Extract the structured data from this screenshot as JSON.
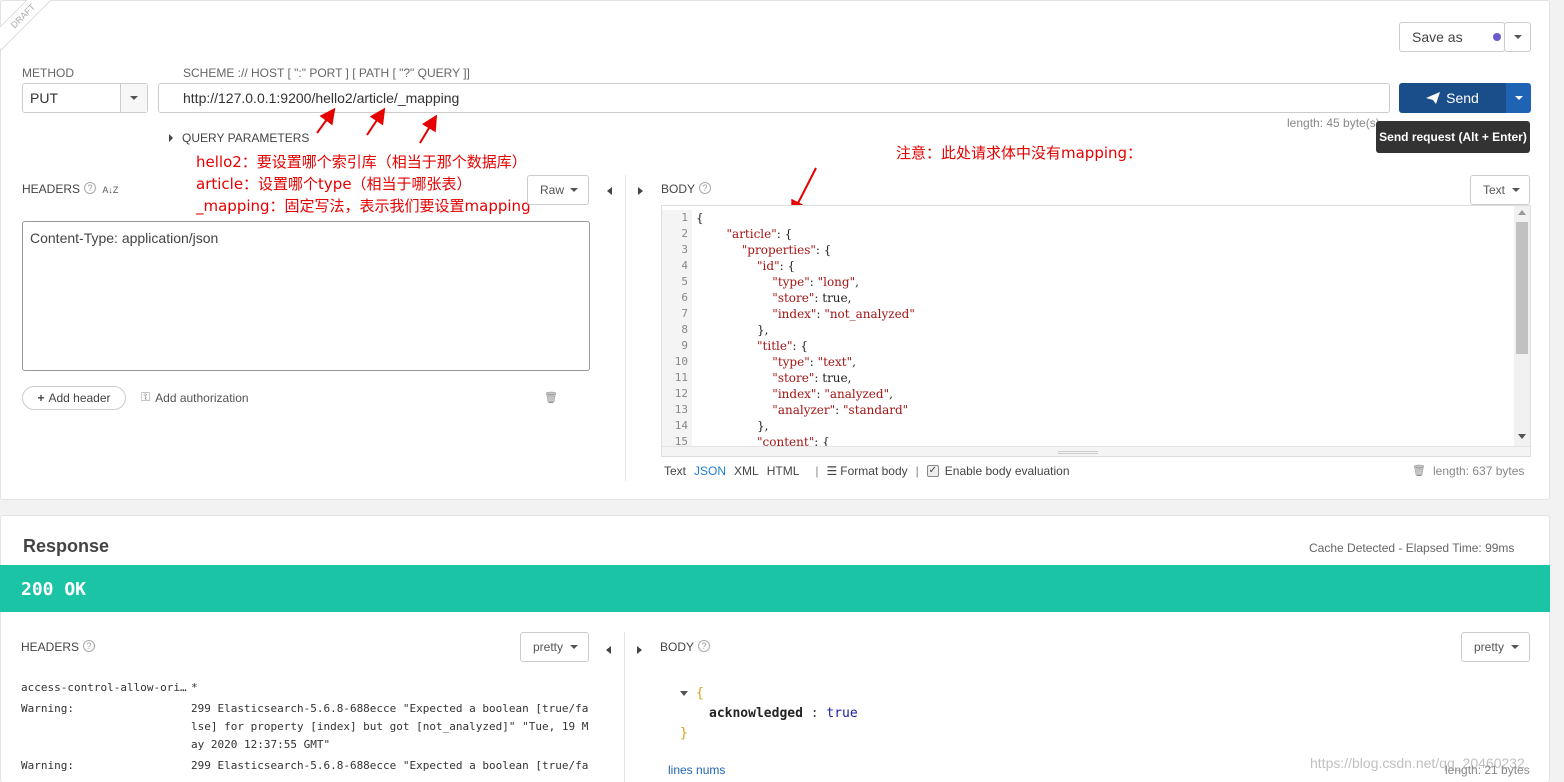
{
  "draft_label": "DRAFT",
  "save_as_label": "Save as",
  "method": {
    "label": "METHOD",
    "value": "PUT"
  },
  "url": {
    "label": "SCHEME :// HOST [ \":\" PORT ] [ PATH [ \"?\" QUERY ]]",
    "value": "http://127.0.0.1:9200/hello2/article/_mapping",
    "length": "length: 45 byte(s)"
  },
  "send_label": "Send",
  "send_tooltip": "Send request (Alt + Enter)",
  "query_parameters_label": "QUERY PARAMETERS",
  "annotations": {
    "line1": "hello2：要设置哪个索引库（相当于那个数据库）",
    "line2": "article：设置哪个type（相当于哪张表）",
    "line3": "_mapping：固定写法，表示我们要设置mapping",
    "body_note": "注意：此处请求体中没有mapping："
  },
  "request_headers": {
    "label": "HEADERS",
    "sort_icon": "A↓Z",
    "mode": "Raw",
    "content": "Content-Type: application/json",
    "add_header": "Add header",
    "add_authorization": "Add authorization"
  },
  "request_body": {
    "label": "BODY",
    "mode": "Text",
    "line_numbers": [
      "1",
      "2",
      "3",
      "4",
      "5",
      "6",
      "7",
      "8",
      "9",
      "10",
      "11",
      "12",
      "13",
      "14",
      "15"
    ],
    "lines": [
      "{",
      "        \"article\": {",
      "            \"properties\": {",
      "                \"id\": {",
      "                    \"type\": \"long\",",
      "                    \"store\": true,",
      "                    \"index\": \"not_analyzed\"",
      "                },",
      "                \"title\": {",
      "                    \"type\": \"text\",",
      "                    \"store\": true,",
      "                    \"index\": \"analyzed\",",
      "                    \"analyzer\": \"standard\"",
      "                },",
      "                \"content\": {"
    ],
    "formats": [
      "Text",
      "JSON",
      "XML",
      "HTML"
    ],
    "active_format": "JSON",
    "format_body": "Format body",
    "enable_eval": "Enable body evaluation",
    "length": "length: 637 bytes"
  },
  "response": {
    "title": "Response",
    "cache_info": "Cache Detected - Elapsed Time: 99ms",
    "status": "200 OK",
    "status_color": "#1cc4a6",
    "headers_label": "HEADERS",
    "headers_mode": "pretty",
    "headers": [
      {
        "name": "access-control-allow-ori…",
        "value": "*"
      },
      {
        "name": "Warning:",
        "value": "299 Elasticsearch-5.6.8-688ecce \"Expected a boolean [true/fa",
        "value2": "lse] for property [index] but got [not_analyzed]\" \"Tue, 19 M",
        "value3": "ay 2020 12:37:55 GMT\""
      },
      {
        "name": "Warning:",
        "value": "299 Elasticsearch-5.6.8-688ecce \"Expected a boolean [true/fa"
      }
    ],
    "body_label": "BODY",
    "body_mode": "pretty",
    "body_key": "acknowledged",
    "body_value": "true",
    "lines_nums": "lines nums",
    "length": "length: 21 bytes",
    "watermark": "https://blog.csdn.net/qq_20460232"
  }
}
